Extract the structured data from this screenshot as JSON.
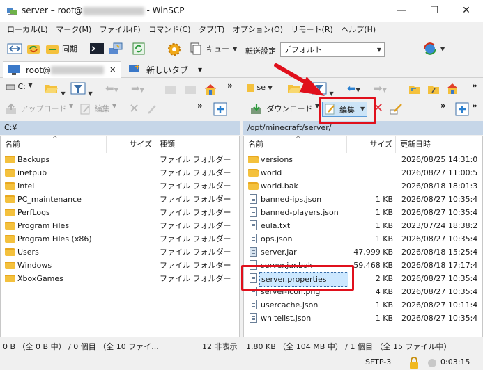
{
  "window": {
    "title_prefix": "server – root@",
    "title_suffix": "- WinSCP",
    "minimize": "—",
    "maximize": "☐",
    "close": "✕"
  },
  "menu": [
    "ローカル(L)",
    "マーク(M)",
    "ファイル(F)",
    "コマンド(C)",
    "タブ(T)",
    "オプション(O)",
    "リモート(R)",
    "ヘルプ(H)"
  ],
  "toolbar1": {
    "sync_label": "同期",
    "queue_label": "キュー",
    "transfer_settings_label": "転送設定",
    "transfer_settings_value": "デフォルト"
  },
  "tabs": {
    "session_prefix": "root@",
    "close": "✕",
    "new_tab": "新しいタブ",
    "new_tab_dropdown": "▾"
  },
  "local": {
    "drive": "C:",
    "upload_label": "アップロード",
    "edit_label": "編集",
    "path": "C:¥",
    "columns": {
      "name": "名前",
      "size": "サイズ",
      "type": "種類"
    },
    "files": [
      {
        "name": "Backups",
        "type": "ファイル フォルダー"
      },
      {
        "name": "inetpub",
        "type": "ファイル フォルダー"
      },
      {
        "name": "Intel",
        "type": "ファイル フォルダー"
      },
      {
        "name": "PC_maintenance",
        "type": "ファイル フォルダー"
      },
      {
        "name": "PerfLogs",
        "type": "ファイル フォルダー"
      },
      {
        "name": "Program Files",
        "type": "ファイル フォルダー"
      },
      {
        "name": "Program Files (x86)",
        "type": "ファイル フォルダー"
      },
      {
        "name": "Users",
        "type": "ファイル フォルダー"
      },
      {
        "name": "Windows",
        "type": "ファイル フォルダー"
      },
      {
        "name": "XboxGames",
        "type": "ファイル フォルダー"
      }
    ],
    "status_left": "0 B （全 0 B 中） / 0 個目 （全 10 ファイ...",
    "status_hidden": "12 非表示"
  },
  "remote": {
    "dir_combo": "se",
    "download_label": "ダウンロード",
    "edit_label": "編集",
    "path": "/opt/minecraft/server/",
    "columns": {
      "name": "名前",
      "size": "サイズ",
      "modified": "更新日時"
    },
    "files": [
      {
        "name": "versions",
        "kind": "folder",
        "size": "",
        "modified": "2026/08/25 14:31:0"
      },
      {
        "name": "world",
        "kind": "folder",
        "size": "",
        "modified": "2026/08/27 11:00:5"
      },
      {
        "name": "world.bak",
        "kind": "folder",
        "size": "",
        "modified": "2026/08/18 18:01:3"
      },
      {
        "name": "banned-ips.json",
        "kind": "file",
        "size": "1 KB",
        "modified": "2026/08/27 10:35:4"
      },
      {
        "name": "banned-players.json",
        "kind": "file",
        "size": "1 KB",
        "modified": "2026/08/27 10:35:4"
      },
      {
        "name": "eula.txt",
        "kind": "file",
        "size": "1 KB",
        "modified": "2023/07/24 18:38:2"
      },
      {
        "name": "ops.json",
        "kind": "file",
        "size": "1 KB",
        "modified": "2026/08/27 10:35:4"
      },
      {
        "name": "server.jar",
        "kind": "jar",
        "size": "47,999 KB",
        "modified": "2026/08/18 15:25:4"
      },
      {
        "name": "server.jar.bak",
        "kind": "file",
        "size": "59,468 KB",
        "modified": "2026/08/18 17:17:4"
      },
      {
        "name": "server.properties",
        "kind": "file",
        "size": "2 KB",
        "modified": "2026/08/27 10:35:4"
      },
      {
        "name": "server-icon.png",
        "kind": "file",
        "size": "4 KB",
        "modified": "2026/08/27 10:35:4"
      },
      {
        "name": "usercache.json",
        "kind": "file",
        "size": "1 KB",
        "modified": "2026/08/27 10:11:4"
      },
      {
        "name": "whitelist.json",
        "kind": "file",
        "size": "1 KB",
        "modified": "2026/08/27 10:35:4"
      }
    ],
    "status_left": "1.80 KB （全 104 MB 中） / 1 個目 （全 15 ファイル中）"
  },
  "statusbar": {
    "protocol": "SFTP-3",
    "elapsed": "0:03:15"
  },
  "colors": {
    "highlight": "#e0101c",
    "path_bar": "#c6d6e8",
    "folder": "#f4c13d",
    "selected": "#cce8ff"
  }
}
